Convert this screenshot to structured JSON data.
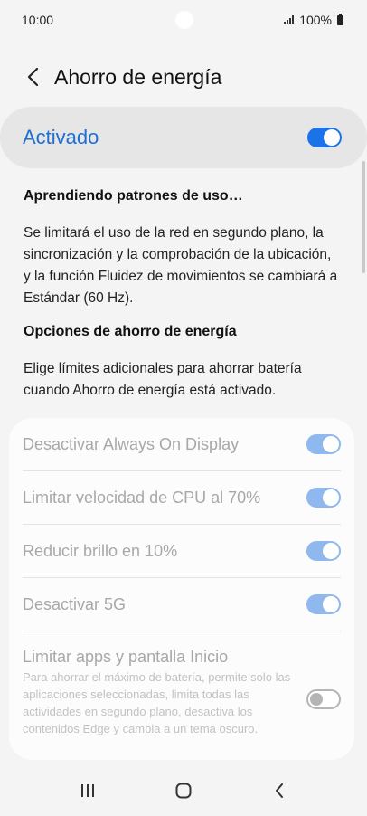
{
  "status": {
    "time": "10:00",
    "battery": "100%"
  },
  "header": {
    "title": "Ahorro de energía",
    "back_icon": "back-arrow-icon"
  },
  "master": {
    "label": "Activado",
    "enabled": true,
    "accent": "#1a73e8"
  },
  "learning": {
    "title": "Aprendiendo patrones de uso…",
    "text": "Se limitará el uso de la red en segundo plano, la sincronización y la comprobación de la ubicación, y la función Fluidez de movimientos se cambiará a Estándar (60 Hz)."
  },
  "options_section": {
    "title": "Opciones de ahorro de energía",
    "text": "Elige límites adicionales para ahorrar batería cuando Ahorro de energía está activado."
  },
  "options": [
    {
      "label": "Desactivar Always On Display",
      "enabled": true
    },
    {
      "label": "Limitar velocidad de CPU al 70%",
      "enabled": true
    },
    {
      "label": "Reducir brillo en 10%",
      "enabled": true
    },
    {
      "label": "Desactivar 5G",
      "enabled": true
    },
    {
      "label": "Limitar apps y pantalla Inicio",
      "description": "Para ahorrar el máximo de batería, permite solo las aplicaciones seleccionadas, limita todas las actividades en segundo plano, desactiva los contenidos Edge y cambia a un tema oscuro.",
      "enabled": false
    }
  ],
  "nav": {
    "recents_icon": "recents-icon",
    "home_icon": "home-icon",
    "back_icon": "back-icon"
  }
}
